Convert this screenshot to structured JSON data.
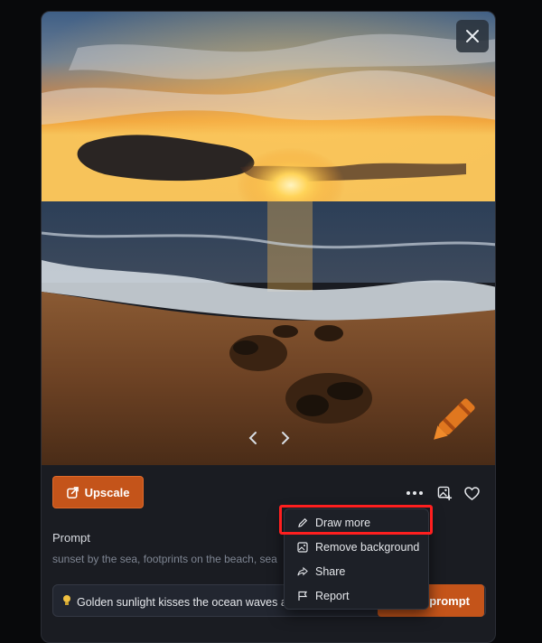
{
  "viewer": {
    "close_icon": "close-icon",
    "prev_icon": "chevron-left-icon",
    "next_icon": "chevron-right-icon"
  },
  "toolbar": {
    "upscale_label": "Upscale",
    "upscale_icon": "external-link-icon",
    "more_icon": "more-horizontal-icon",
    "add_image_icon": "image-plus-icon",
    "like_icon": "heart-icon"
  },
  "prompt": {
    "label": "Prompt",
    "text": "sunset by the sea, footprints on the beach, sea"
  },
  "suggestion": {
    "icon": "lightbulb-icon",
    "text": "Golden sunlight kisses the ocean waves a",
    "button_label": "prompt"
  },
  "menu": {
    "items": [
      {
        "label": "Draw more",
        "icon": "pencil-icon"
      },
      {
        "label": "Remove background",
        "icon": "image-icon"
      },
      {
        "label": "Share",
        "icon": "share-icon"
      },
      {
        "label": "Report",
        "icon": "flag-icon"
      }
    ]
  },
  "colors": {
    "accent": "#c4541a",
    "highlight": "#ff1f1f",
    "panel": "#1a1c22"
  }
}
